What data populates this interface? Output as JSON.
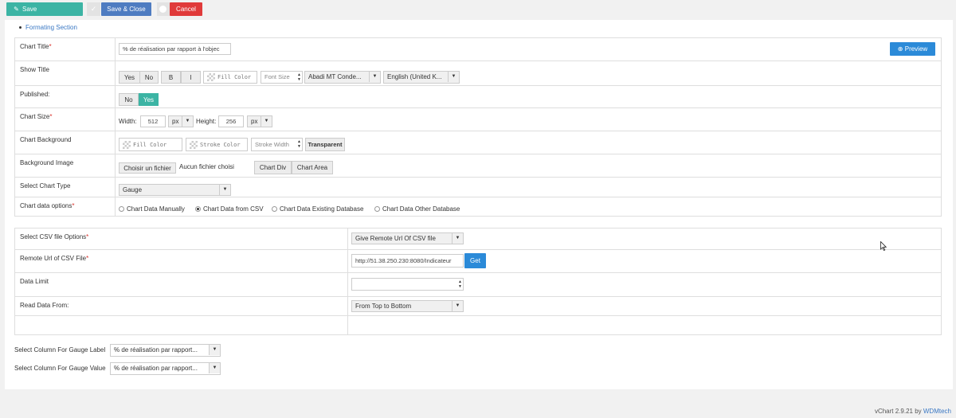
{
  "toolbar": {
    "save_label": "Save",
    "save_close_label": "Save & Close",
    "cancel_label": "Cancel"
  },
  "section_link": "Formating Section",
  "form": {
    "chart_title": {
      "label": "Chart Title",
      "required": "*",
      "value": "% de réalisation par rapport à l'objec",
      "preview_label": "Preview"
    },
    "show_title": {
      "label": "Show Title",
      "yes": "Yes",
      "no": "No",
      "bold": "B",
      "italic": "I",
      "fill_color": "Fill Color",
      "font_size": "Font Size",
      "font_family": "Abadi MT Conde...",
      "language": "English (United K..."
    },
    "published": {
      "label": "Published:",
      "no": "No",
      "yes": "Yes"
    },
    "chart_size": {
      "label": "Chart Size",
      "required": "*",
      "width_label": "Width:",
      "width": "512",
      "width_unit": "px",
      "height_label": "Height:",
      "height": "256",
      "height_unit": "px"
    },
    "chart_background": {
      "label": "Chart Background",
      "fill_color": "Fill Color",
      "stroke_color": "Stroke Color",
      "stroke_width": "Stroke Width",
      "transparent": "Transparent"
    },
    "background_image": {
      "label": "Background Image",
      "choose_file": "Choisir un fichier",
      "no_file": "Aucun fichier choisi",
      "chart_div": "Chart Div",
      "chart_area": "Chart Area"
    },
    "chart_type": {
      "label": "Select Chart Type",
      "value": "Gauge"
    },
    "data_options": {
      "label": "Chart data options",
      "required": "*",
      "options": [
        "Chart Data Manually",
        "Chart Data from CSV",
        "Chart Data Existing Database",
        "Chart Data Other Database"
      ],
      "selected": 1
    }
  },
  "csv": {
    "file_options": {
      "label": "Select CSV file Options",
      "required": "*",
      "value": "Give Remote Url Of CSV file"
    },
    "remote_url": {
      "label": "Remote Url of CSV File",
      "required": "*",
      "value": "http://51.38.250.230:8080/Indicateur",
      "get_label": "Get"
    },
    "data_limit": {
      "label": "Data Limit",
      "value": ""
    },
    "read_from": {
      "label": "Read Data From:",
      "value": "From Top to Bottom"
    }
  },
  "gauge": {
    "label_column": {
      "label": "Select Column For Gauge Label",
      "value": "% de réalisation par rapport..."
    },
    "value_column": {
      "label": "Select Column For Gauge Value",
      "value": "% de réalisation par rapport..."
    }
  },
  "footer": {
    "product": "vChart 2.9.21 by",
    "vendor": "WDMtech"
  },
  "colors": {
    "save": "#3cb4a4",
    "save_close": "#4e7cc1",
    "cancel": "#e03a3a",
    "link": "#3a78c4",
    "primary": "#2b8ad8"
  },
  "icons": [
    "edit-icon",
    "check-icon",
    "clock-icon",
    "plus-circle-icon",
    "caret-down-icon",
    "cursor-icon"
  ]
}
